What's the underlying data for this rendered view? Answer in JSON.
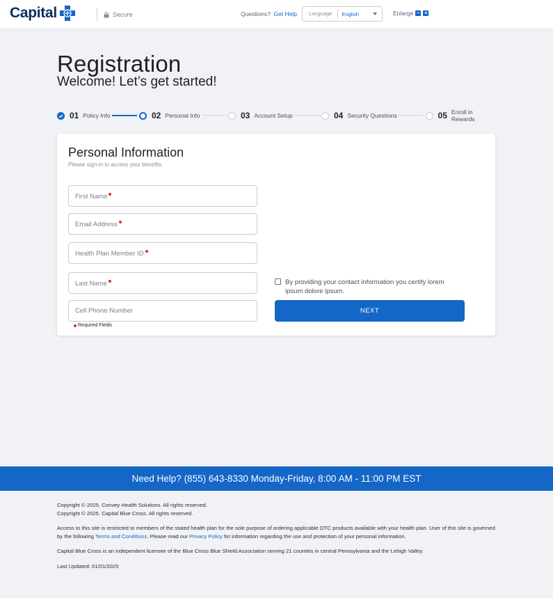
{
  "header": {
    "logo_text": "Capital",
    "secure_label": "Secure",
    "questions_label": "Questions?",
    "get_help_link": "Get Help",
    "language_label": "Language",
    "language_value": "English",
    "enlarge_label": "Enlarge",
    "zoom_out_glyph": "−",
    "zoom_in_glyph": "+"
  },
  "page": {
    "title": "Registration",
    "subtitle": "Welcome! Let’s get started!"
  },
  "stepper": [
    {
      "num": "01",
      "label": "Policy Info",
      "state": "done"
    },
    {
      "num": "02",
      "label": "Personal Info",
      "state": "active"
    },
    {
      "num": "03",
      "label": "Account Setup",
      "state": "pending"
    },
    {
      "num": "04",
      "label": "Security Questions",
      "state": "pending"
    },
    {
      "num": "05",
      "label": "Enroll in Rewards",
      "state": "pending"
    }
  ],
  "form": {
    "title": "Personal Information",
    "subtitle": "Please sign-in to access your benefits.",
    "first_name": "First Name",
    "email": "Email Address",
    "member_id": "Health Plan Member ID",
    "last_name": "Last Name",
    "cell_phone": "Cell Phone Number",
    "required_note": "Required Fields",
    "consent_text": "By providing your contact information you certify lorem ipsum dolore ipsum.",
    "next_label": "NEXT"
  },
  "footer": {
    "help_banner": "Need Help? (855) 643-8330 Monday-Friday, 8:00 AM - 11:00 PM EST",
    "copyright1": "Copyright © 2025. Convey Health Solutions. All rights reserved.",
    "copyright2": "Copyright © 2025. Capital Blue Cross. All rights reserved.",
    "access_part1": "Access to this site is restricted to members of the stated health plan for the sole purpose of ordering applicable OTC products available with your health plan. User of this site is governed by the following ",
    "terms_link": "Terms and Conditions",
    "access_part2": ". Please read our ",
    "privacy_link": "Privacy Policy",
    "access_part3": " for information regarding the use and protection of your personal information.",
    "licensee": "Capital Blue Cross is an independent licensee of the Blue Cross Blue Shield Association serving 21 counties in central Pennsylvania and the Lehigh Valley.",
    "last_updated": "Last Updated: 01/01/2025"
  },
  "colors": {
    "accent": "#1466c7",
    "brand_navy": "#0b2c5c",
    "required": "#e0301e",
    "background": "#f1f2f6"
  }
}
